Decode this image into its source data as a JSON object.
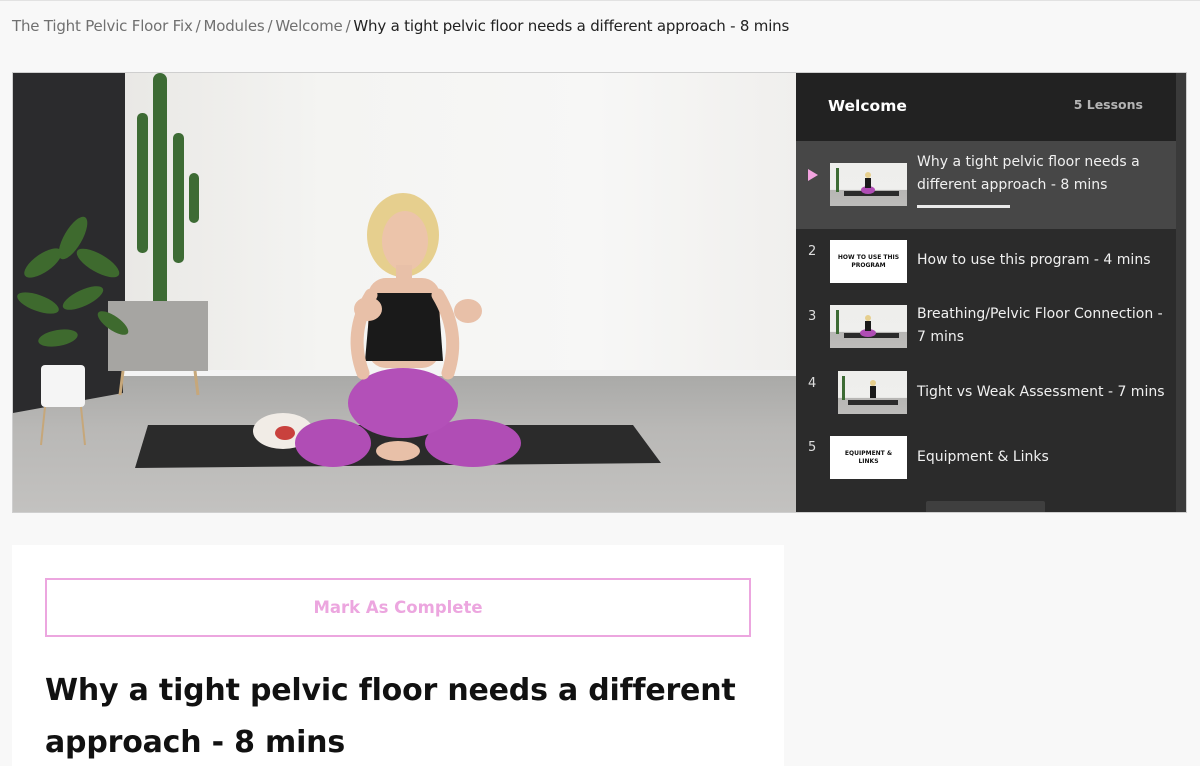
{
  "breadcrumb": {
    "course": "The Tight Pelvic Floor Fix",
    "modules": "Modules",
    "module": "Welcome",
    "separator": "/",
    "current": "Why a tight pelvic floor needs a different approach - 8 mins"
  },
  "sidebar": {
    "title": "Welcome",
    "count": "5 Lessons",
    "lessons": [
      {
        "num": "",
        "title": "Why a tight pelvic floor needs a different approach - 8 mins",
        "thumb_text": "",
        "active": true,
        "progress": 0.45
      },
      {
        "num": "2",
        "title": "How to use this program - 4 mins",
        "thumb_text": "HOW TO USE THIS PROGRAM",
        "active": false
      },
      {
        "num": "3",
        "title": "Breathing/Pelvic Floor Connection - 7 mins",
        "thumb_text": "",
        "active": false
      },
      {
        "num": "4",
        "title": "Tight vs Weak Assessment - 7 mins",
        "thumb_text": "",
        "active": false
      },
      {
        "num": "5",
        "title": "Equipment & Links",
        "thumb_text": "EQUIPMENT & LINKS",
        "active": false
      }
    ]
  },
  "content": {
    "mark_complete": "Mark As Complete",
    "heading": "Why a tight pelvic floor needs a different approach - 8 mins"
  },
  "colors": {
    "accent": "#eca6df",
    "play_marker": "#f2a3df",
    "sidebar_bg": "#2b2b2b",
    "active_lesson_bg": "#474747"
  },
  "icons": {
    "active_marker": "play-triangle-icon"
  }
}
